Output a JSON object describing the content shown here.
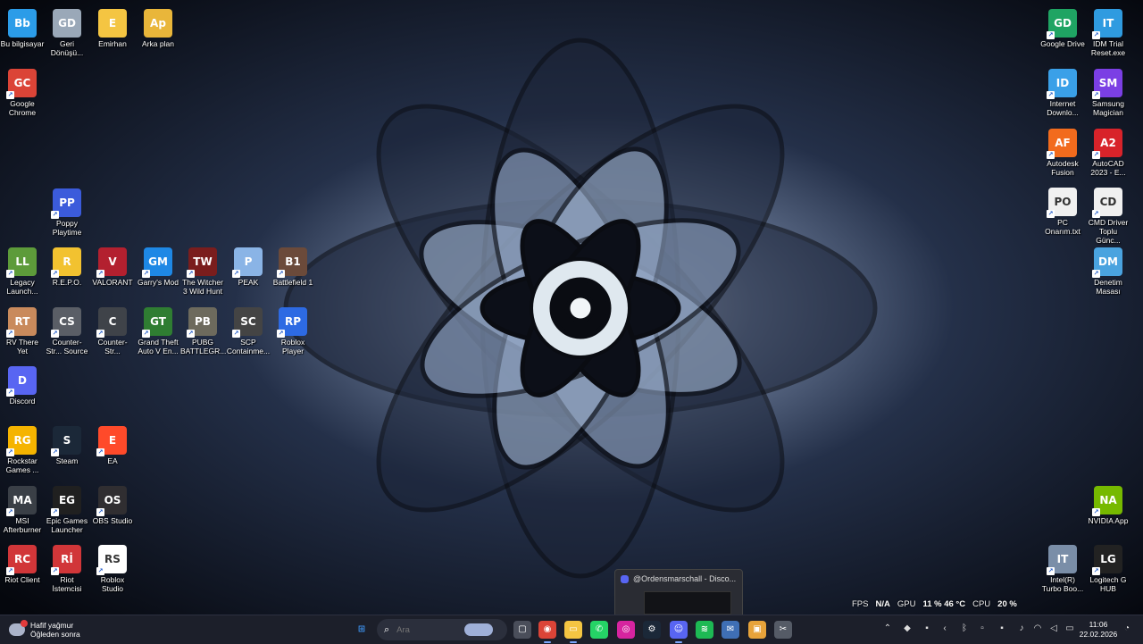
{
  "desktop": {
    "icons_left": [
      {
        "label": "Bu bilgisayar",
        "icon": "monitor-icon",
        "color": "#2b9ce8"
      },
      {
        "label": "Geri Dönüşü...",
        "icon": "recycle-bin-icon",
        "color": "#9aa8b8"
      },
      {
        "label": "Emirhan",
        "icon": "folder-icon",
        "color": "#f4c542"
      },
      {
        "label": "Arka plan",
        "icon": "folder-icon",
        "color": "#e9b63a"
      },
      {
        "label": "Google Chrome",
        "icon": "chrome-icon",
        "color": "#db4437"
      },
      {
        "label": "Poppy Playtime",
        "icon": "poppy-playtime-icon",
        "color": "#3b5bdb"
      },
      {
        "label": "Legacy Launch...",
        "icon": "minecraft-icon",
        "color": "#5d9b3a"
      },
      {
        "label": "R.E.P.O.",
        "icon": "repo-icon",
        "color": "#f2c230"
      },
      {
        "label": "VALORANT",
        "icon": "valorant-icon",
        "color": "#b3202f"
      },
      {
        "label": "Garry's Mod",
        "icon": "gmod-icon",
        "color": "#1e88e5"
      },
      {
        "label": "The Witcher 3 Wild Hunt",
        "icon": "witcher-icon",
        "color": "#7a1d1d"
      },
      {
        "label": "PEAK",
        "icon": "peak-icon",
        "color": "#8ab4e6"
      },
      {
        "label": "Battlefield 1",
        "icon": "battlefield-icon",
        "color": "#6b4a3a"
      },
      {
        "label": "RV There Yet",
        "icon": "rv-there-yet-icon",
        "color": "#c98a5c"
      },
      {
        "label": "Counter-Str... Source",
        "icon": "counter-strike-source-icon",
        "color": "#5a5e66"
      },
      {
        "label": "Counter-Str...",
        "icon": "counter-strike-icon",
        "color": "#3f4349"
      },
      {
        "label": "Grand Theft Auto V En...",
        "icon": "gta-v-icon",
        "color": "#2f7d32"
      },
      {
        "label": "PUBG BATTLEGR...",
        "icon": "pubg-icon",
        "color": "#6d6a5d"
      },
      {
        "label": "SCP Containme...",
        "icon": "scp-icon",
        "color": "#444444"
      },
      {
        "label": "Roblox Player",
        "icon": "roblox-player-icon",
        "color": "#2d6ae3"
      },
      {
        "label": "Discord",
        "icon": "discord-icon",
        "color": "#5865f2"
      },
      {
        "label": "Rockstar Games ...",
        "icon": "rockstar-icon",
        "color": "#f5b400"
      },
      {
        "label": "Steam",
        "icon": "steam-icon",
        "color": "#1b2838"
      },
      {
        "label": "EA",
        "icon": "ea-icon",
        "color": "#ff4a2a"
      },
      {
        "label": "MSI Afterburner",
        "icon": "msi-afterburner-icon",
        "color": "#3a3f46"
      },
      {
        "label": "Epic Games Launcher",
        "icon": "epic-games-icon",
        "color": "#202020"
      },
      {
        "label": "OBS Studio",
        "icon": "obs-icon",
        "color": "#302e31"
      },
      {
        "label": "Riot Client",
        "icon": "riot-client-icon",
        "color": "#d13639"
      },
      {
        "label": "Riot İstemcisi",
        "icon": "riot-istemcisi-icon",
        "color": "#d13639"
      },
      {
        "label": "Roblox Studio",
        "icon": "roblox-studio-icon",
        "color": "#ffffff"
      }
    ],
    "icons_right": [
      {
        "label": "Google Drive",
        "icon": "google-drive-icon",
        "color": "#1fa463"
      },
      {
        "label": "IDM Trial Reset.exe",
        "icon": "idm-icon",
        "color": "#2f9be0"
      },
      {
        "label": "Internet Downlo...",
        "icon": "internet-download-manager-icon",
        "color": "#3aa0e8"
      },
      {
        "label": "Samsung Magician",
        "icon": "samsung-magician-icon",
        "color": "#7b3fe4"
      },
      {
        "label": "Autodesk Fusion",
        "icon": "autodesk-fusion-icon",
        "color": "#f26b1d"
      },
      {
        "label": "AutoCAD 2023 - E...",
        "icon": "autocad-icon",
        "color": "#d8232a"
      },
      {
        "label": "PC Onarım.txt",
        "icon": "text-file-icon",
        "color": "#f0f0f0"
      },
      {
        "label": "CMD Driver Toplu Günc...",
        "icon": "text-file-icon",
        "color": "#f0f0f0"
      },
      {
        "label": "Denetim Masası",
        "icon": "control-panel-icon",
        "color": "#4aa3df"
      },
      {
        "label": "NVIDIA App",
        "icon": "nvidia-icon",
        "color": "#76b900"
      },
      {
        "label": "Intel(R) Turbo Boo...",
        "icon": "intel-turbo-boost-icon",
        "color": "#7a8ea8"
      },
      {
        "label": "Logitech G HUB",
        "icon": "logitech-ghub-icon",
        "color": "#222222"
      }
    ]
  },
  "perf_overlay": {
    "fps_label": "FPS",
    "fps_value": "N/A",
    "gpu_label": "GPU",
    "gpu_value": "11 % 46 °C",
    "cpu_label": "CPU",
    "cpu_value": "20 %"
  },
  "discord_preview": {
    "title": "@Ordensmarschall - Disco..."
  },
  "taskbar": {
    "weather": {
      "line1": "Hafif yağmur",
      "line2": "Öğleden sonra",
      "badge": "1"
    },
    "search_placeholder": "Ara",
    "apps": [
      {
        "icon": "windows-start-icon",
        "color": "#3b8ee8",
        "glyph": "⊞"
      },
      {
        "icon": "task-view-icon",
        "color": "#4a4e5a",
        "glyph": "▢"
      },
      {
        "icon": "chrome-icon",
        "color": "#db4437",
        "glyph": "◉"
      },
      {
        "icon": "file-explorer-icon",
        "color": "#f4c542",
        "glyph": "▭"
      },
      {
        "icon": "whatsapp-icon",
        "color": "#25d366",
        "glyph": "✆"
      },
      {
        "icon": "instagram-icon",
        "color": "#d6249f",
        "glyph": "◎"
      },
      {
        "icon": "steam-icon",
        "color": "#1b2838",
        "glyph": "⚙"
      },
      {
        "icon": "discord-icon",
        "color": "#5865f2",
        "glyph": "☺"
      },
      {
        "icon": "spotify-icon",
        "color": "#1db954",
        "glyph": "≋"
      },
      {
        "icon": "mail-icon",
        "color": "#3f6fb5",
        "glyph": "✉"
      },
      {
        "icon": "microsoft-store-icon",
        "color": "#e7a33a",
        "glyph": "▣"
      },
      {
        "icon": "snipping-tool-icon",
        "color": "#555b66",
        "glyph": "✂"
      }
    ],
    "tray_icons": [
      "chevron-up-icon",
      "antivirus-icon",
      "network-icon",
      "bluetooth-icon",
      "volume-icon"
    ],
    "clock_time": "11:06",
    "clock_date": "22.02.2026"
  }
}
